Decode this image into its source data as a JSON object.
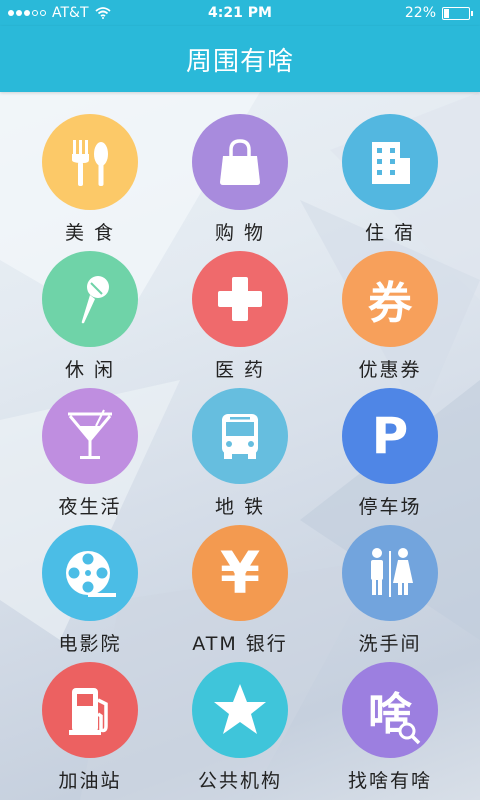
{
  "status_bar": {
    "carrier": "AT&T",
    "time": "4:21 PM",
    "battery_percent": "22%",
    "battery_level": 0.22
  },
  "nav": {
    "title": "周围有啥"
  },
  "categories": [
    {
      "label": "美 食",
      "icon": "fork-spoon-icon",
      "color": "#fcc968"
    },
    {
      "label": "购 物",
      "icon": "shopping-bag-icon",
      "color": "#a88bdd"
    },
    {
      "label": "住 宿",
      "icon": "building-icon",
      "color": "#53b7e0"
    },
    {
      "label": "休 闲",
      "icon": "microphone-icon",
      "color": "#6fd3a8"
    },
    {
      "label": "医 药",
      "icon": "medical-cross-icon",
      "color": "#ef6a6c"
    },
    {
      "label": "优惠券",
      "icon": "coupon-icon",
      "color": "#f7a05b",
      "glyph": "券"
    },
    {
      "label": "夜生活",
      "icon": "cocktail-glass-icon",
      "color": "#bf8ee0"
    },
    {
      "label": "地 铁",
      "icon": "bus-icon",
      "color": "#66bedf"
    },
    {
      "label": "停车场",
      "icon": "parking-icon",
      "color": "#4f86e6",
      "glyph": "P"
    },
    {
      "label": "电影院",
      "icon": "film-reel-icon",
      "color": "#4bbde6"
    },
    {
      "label": "ATM 银行",
      "icon": "yen-icon",
      "color": "#f39a50",
      "glyph": "¥"
    },
    {
      "label": "洗手间",
      "icon": "restroom-icon",
      "color": "#72a4dd"
    },
    {
      "label": "加油站",
      "icon": "fuel-pump-icon",
      "color": "#ec6161"
    },
    {
      "label": "公共机构",
      "icon": "star-icon",
      "color": "#3fc5da"
    },
    {
      "label": "找啥有啥",
      "icon": "search-glyph-icon",
      "color": "#9c7fe0",
      "glyph": "啥"
    }
  ]
}
